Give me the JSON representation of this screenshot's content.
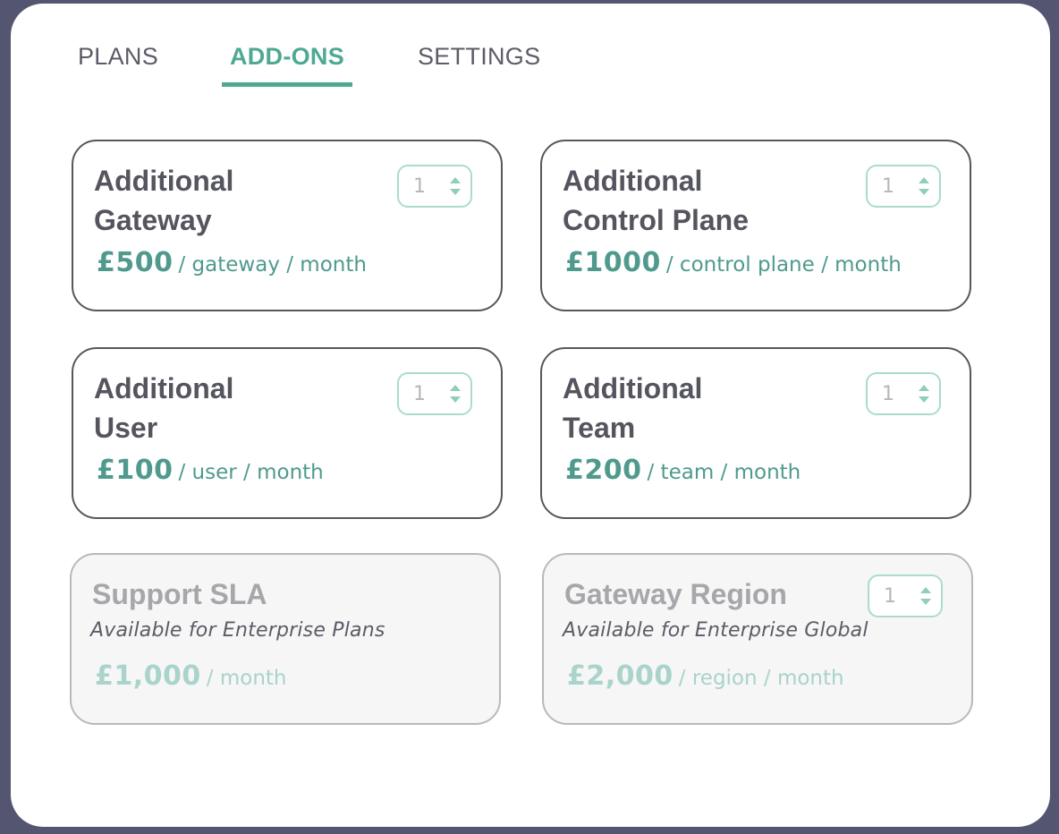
{
  "tabs": {
    "plans": "PLANS",
    "addons": "ADD-ONS",
    "settings": "SETTINGS",
    "active": "ADD-ONS"
  },
  "cards": [
    {
      "title_line1": "Additional",
      "title_line2": "Gateway",
      "amount": "£500",
      "unit": "/ gateway / month",
      "quantity": "1",
      "enabled": true
    },
    {
      "title_line1": "Additional",
      "title_line2": "Control Plane",
      "amount": "£1000",
      "unit": "/ control plane / month",
      "quantity": "1",
      "enabled": true
    },
    {
      "title_line1": "Additional",
      "title_line2": "User",
      "amount": "£100",
      "unit": "/ user / month",
      "quantity": "1",
      "enabled": true
    },
    {
      "title_line1": "Additional",
      "title_line2": "Team",
      "amount": "£200",
      "unit": "/ team / month",
      "quantity": "1",
      "enabled": true
    },
    {
      "title": "Support SLA",
      "subtitle": "Available for Enterprise Plans",
      "amount": "£1,000",
      "unit": "/ month",
      "enabled": false
    },
    {
      "title": "Gateway Region",
      "subtitle": "Available for Enterprise Global",
      "amount": "£2,000",
      "unit": "/ region / month",
      "quantity": "1",
      "enabled": false
    }
  ],
  "colors": {
    "background": "#545671",
    "accent": "#4fa992",
    "price": "#4f9a8d",
    "stepper_border": "#a9dccf",
    "text": "#54555e",
    "disabled_text": "#a6a7ab"
  }
}
